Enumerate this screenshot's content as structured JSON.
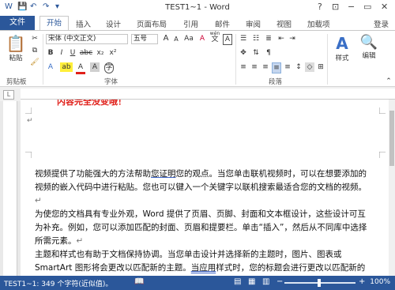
{
  "titlebar": {
    "title": "TEST1~1 - Word",
    "help": "?",
    "minimize": "−",
    "restore": "▭",
    "close": "✕",
    "qat_save_icon": "save-icon",
    "qat_undo_icon": "undo-icon",
    "qat_redo_icon": "redo-icon"
  },
  "tabs": {
    "file": "文件",
    "items": [
      "开始",
      "插入",
      "设计",
      "页面布局",
      "引用",
      "邮件",
      "审阅",
      "视图",
      "加载项"
    ],
    "login": "登录"
  },
  "ribbon": {
    "clipboard": {
      "paste": "粘贴",
      "label": "剪贴板"
    },
    "font": {
      "name": "宋体 (中文正文)",
      "size": "五号",
      "label": "字体",
      "grow": "A",
      "shrink": "A",
      "case": "Aa",
      "clear": "A",
      "wen": "wén",
      "wen_char": "文",
      "a_char": "A",
      "bold": "B",
      "italic": "I",
      "underline": "U",
      "strike": "abc",
      "sub": "x₂",
      "sup": "x²",
      "highlight": "ab",
      "fontcolor": "A",
      "shading": "A",
      "border_char": "A",
      "circle": "字"
    },
    "paragraph": {
      "label": "段落"
    },
    "styles": {
      "label": "样式"
    },
    "editing": {
      "label": "编辑"
    }
  },
  "ruler": {
    "tab_marker": "L"
  },
  "document": {
    "annotation": "内容完全没变哦！",
    "paragraphs": [
      {
        "pre": "视频提供了功能强大的方法帮助",
        "link": "您证明",
        "post": "您的观点。当您单击联机视频时，可以在想要添加的视频的嵌入代码中进行粘贴。您也可以键入一个关键字以联机搜索最适合您的文档的视频。"
      },
      {
        "pre": "为使您的文档具有专业外观，Word 提供了页眉、页脚、封面和文本框设计，这些设计可互为补充。例如，您可以添加匹配的封面、页眉和提要栏。单击“插入”，然后从不同库中选择所需元素。",
        "link": "",
        "post": ""
      },
      {
        "pre": "主题和样式也有助于文档保持协调。当您单击设计并选择新的主题时，图片、图表或 SmartArt 图形将会更改以匹配新的主题。",
        "link": "当应用",
        "post": "样式时，您的标题会进行更改以匹配新的主题。"
      }
    ]
  },
  "statusbar": {
    "words": "TEST1~1: 349 个字符(近似值)。",
    "zoom": "100%",
    "zoom_level_percent": 100,
    "minus": "−",
    "plus": "+"
  }
}
